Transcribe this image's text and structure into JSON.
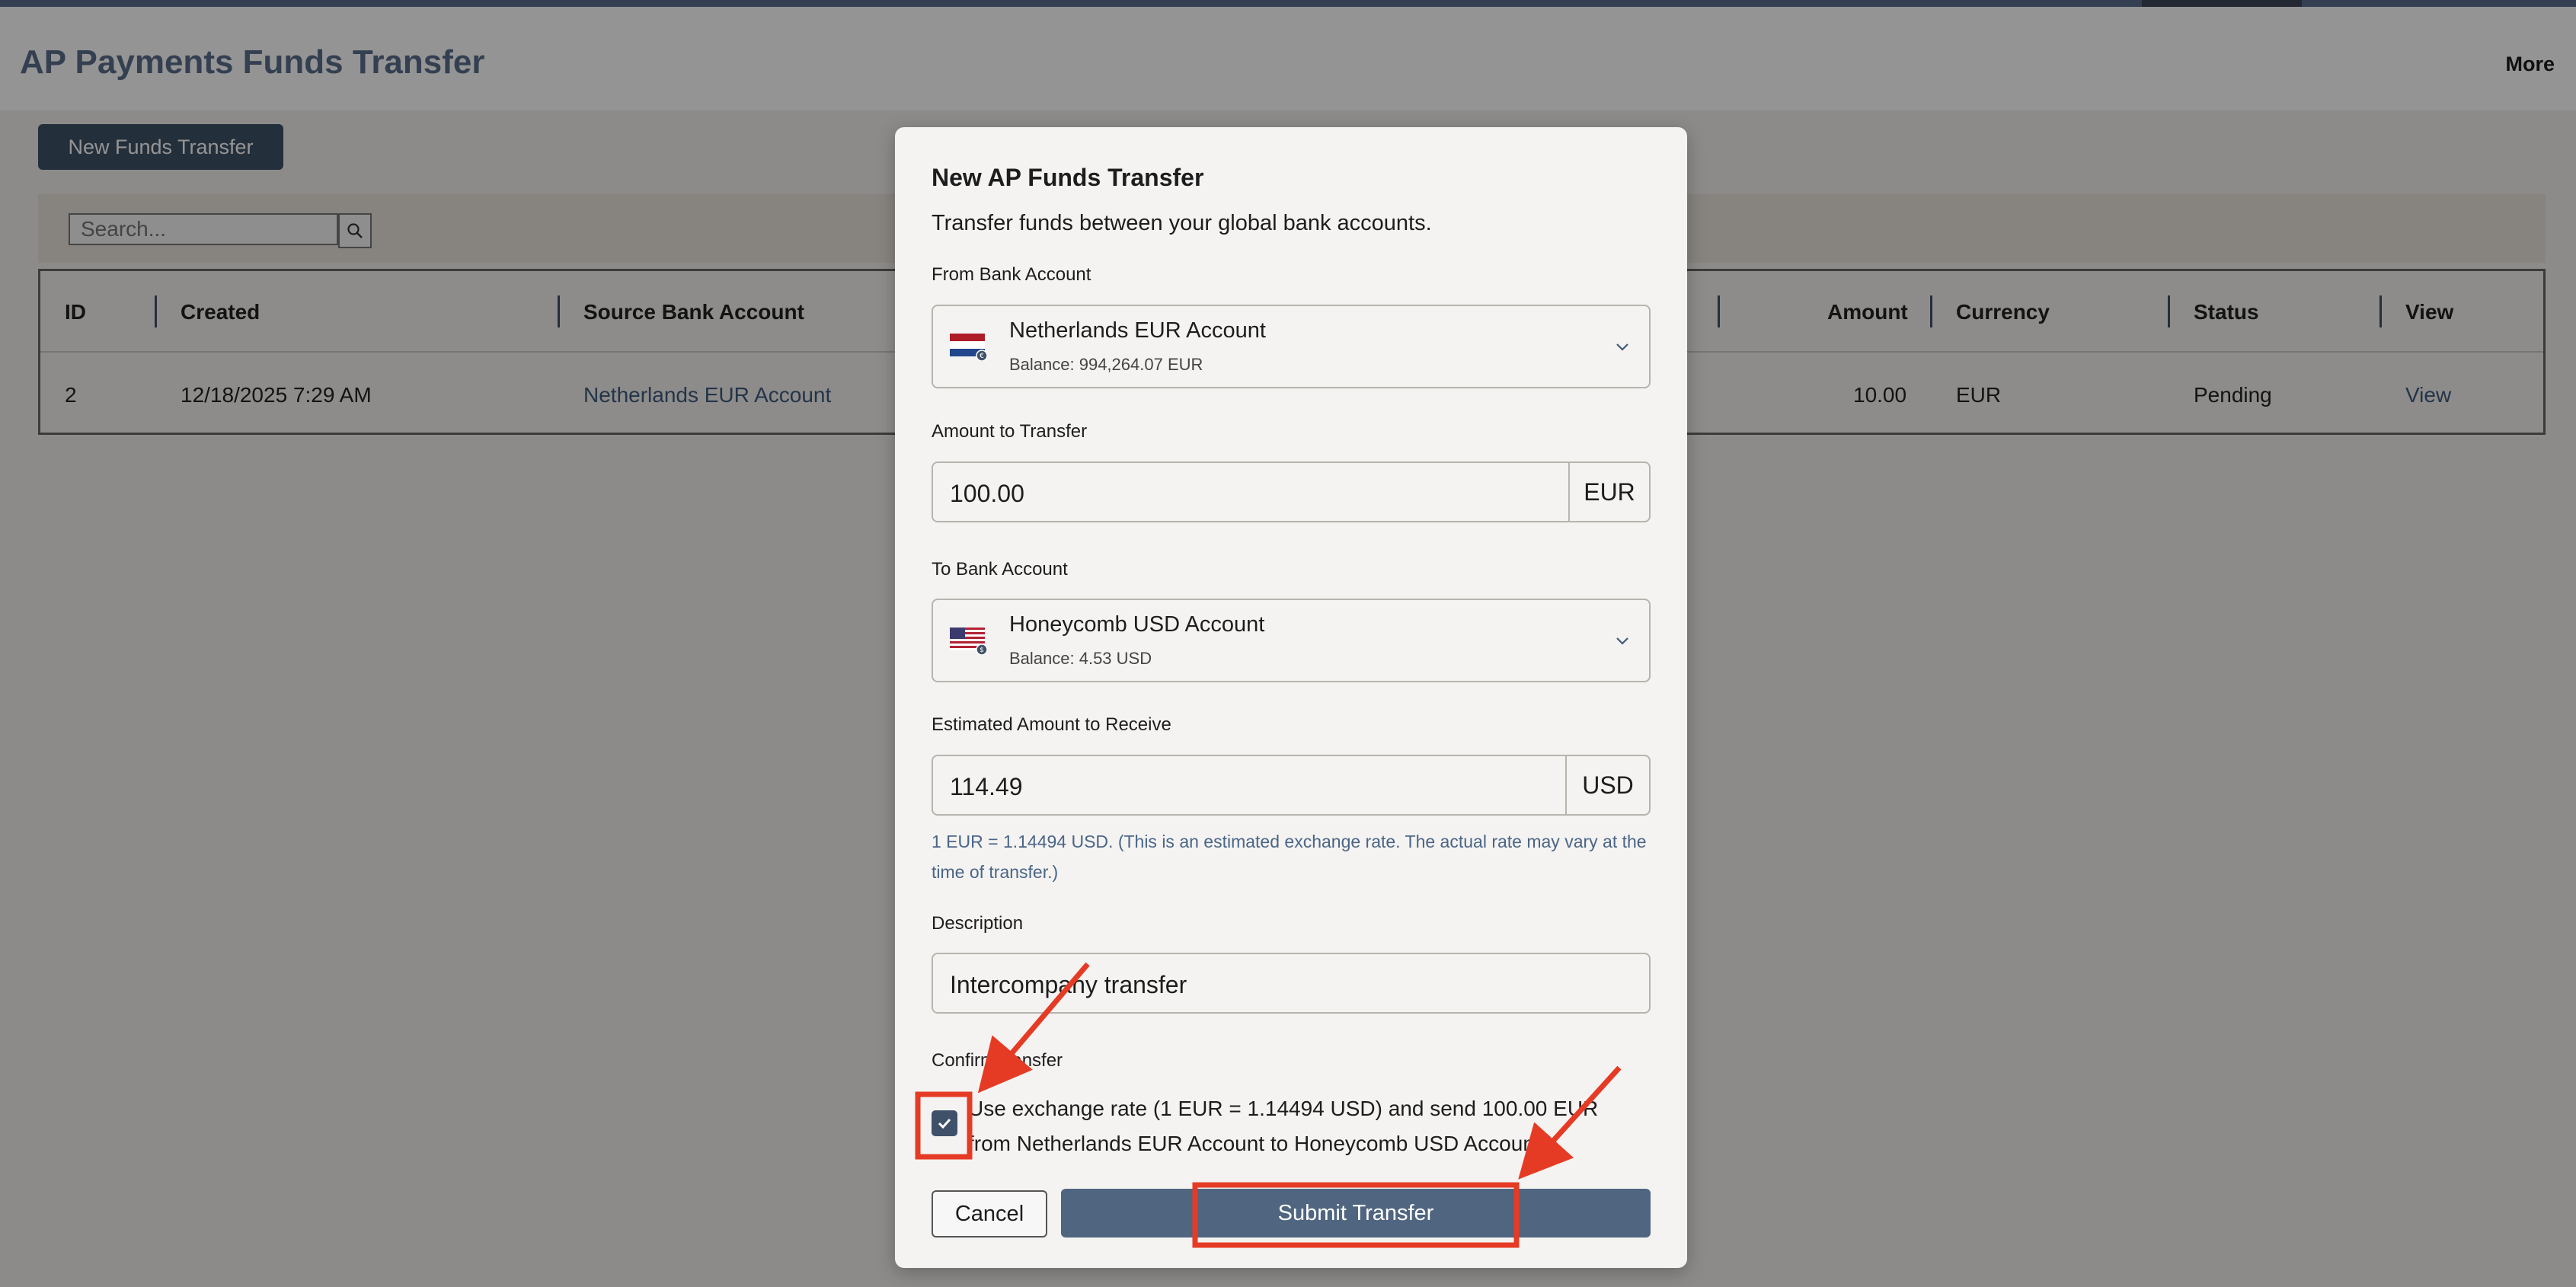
{
  "header": {
    "title": "AP Payments Funds Transfer",
    "more_label": "More"
  },
  "toolbar": {
    "new_transfer_label": "New Funds Transfer"
  },
  "search": {
    "placeholder": "Search..."
  },
  "table": {
    "columns": [
      "ID",
      "Created",
      "Source Bank Account",
      "Amount",
      "Currency",
      "Status",
      "View"
    ],
    "rows": [
      {
        "id": "2",
        "created": "12/18/2025 7:29 AM",
        "source": "Netherlands EUR Account",
        "amount": "10.00",
        "currency": "EUR",
        "status": "Pending",
        "view": "View"
      }
    ]
  },
  "modal": {
    "title": "New AP Funds Transfer",
    "subtitle": "Transfer funds between your global bank accounts.",
    "from_label": "From Bank Account",
    "from_account": {
      "name": "Netherlands EUR Account",
      "balance": "Balance: 994,264.07 EUR",
      "flag_icon": "netherlands-flag-icon"
    },
    "amount_label": "Amount to Transfer",
    "amount_value": "100.00",
    "amount_currency": "EUR",
    "to_label": "To Bank Account",
    "to_account": {
      "name": "Honeycomb USD Account",
      "balance": "Balance: 4.53 USD",
      "flag_icon": "us-flag-icon"
    },
    "estimated_label": "Estimated Amount to Receive",
    "estimated_value": "114.49",
    "estimated_currency": "USD",
    "rate_note": "1 EUR = 1.14494 USD. (This is an estimated exchange rate. The actual rate may vary at the time of transfer.)",
    "description_label": "Description",
    "description_value": "Intercompany transfer",
    "confirm_label": "Confirm transfer",
    "confirm_text": "Use exchange rate (1 EUR = 1.14494 USD) and send 100.00 EUR from Netherlands EUR Account to Honeycomb USD Account.",
    "confirm_checked": true,
    "cancel_label": "Cancel",
    "submit_label": "Submit Transfer"
  },
  "colors": {
    "accent": "#3f5168",
    "submit": "#4f6580",
    "annotation": "#e53b25"
  }
}
